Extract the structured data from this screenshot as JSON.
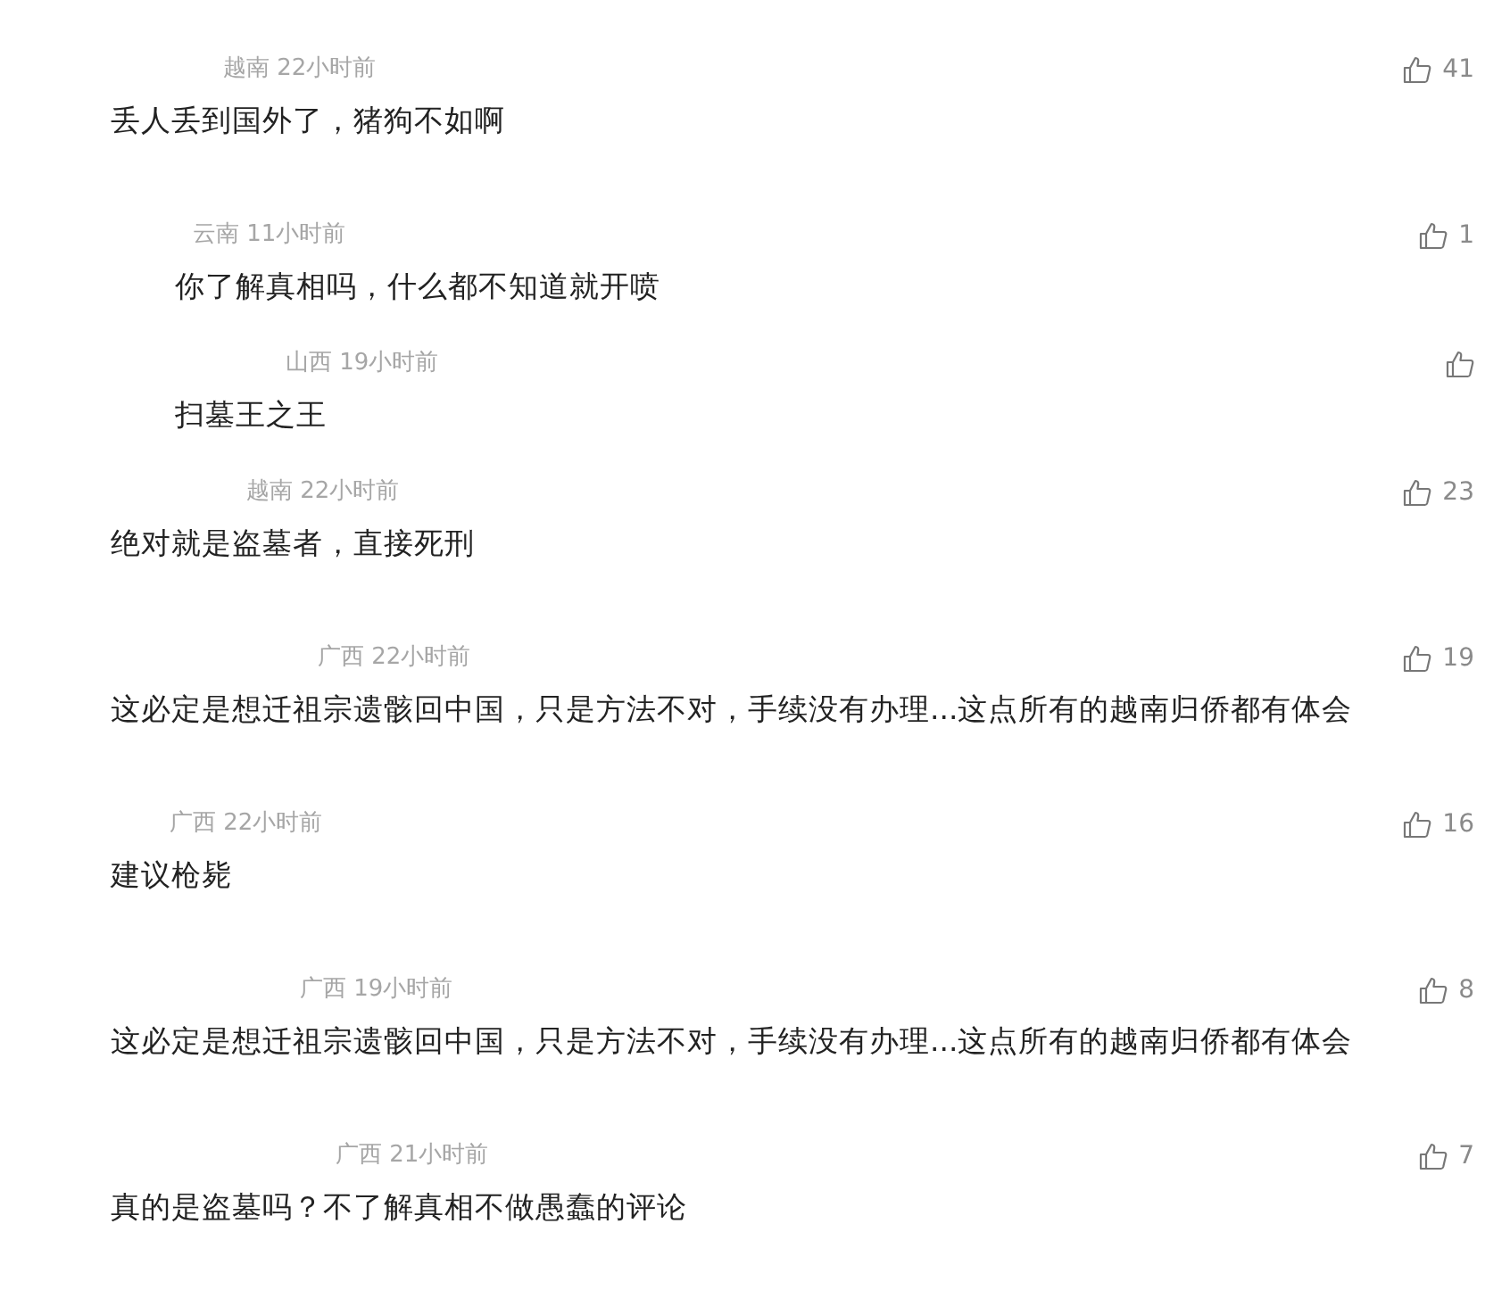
{
  "comments": [
    {
      "location": "越南",
      "time": "22小时前",
      "text": "丢人丢到国外了，猪狗不如啊",
      "likes": "41",
      "children": [
        {
          "location": "云南",
          "time": "11小时前",
          "text": "你了解真相吗，什么都不知道就开喷",
          "likes": "1"
        },
        {
          "location": "山西",
          "time": "19小时前",
          "text": "扫墓王之王"
        }
      ]
    },
    {
      "location": "越南",
      "time": "22小时前",
      "text": "绝对就是盗墓者，直接死刑",
      "likes": "23"
    },
    {
      "location": "广西",
      "time": "22小时前",
      "text": "这必定是想迁祖宗遗骸回中国，只是方法不对，手续没有办理...这点所有的越南归侨都有体会",
      "likes": "19"
    },
    {
      "location": "广西",
      "time": "22小时前",
      "text": "建议枪毙",
      "likes": "16"
    },
    {
      "location": "广西",
      "time": "19小时前",
      "text": "这必定是想迁祖宗遗骸回中国，只是方法不对，手续没有办理...这点所有的越南归侨都有体会",
      "likes": "8"
    },
    {
      "location": "广西",
      "time": "21小时前",
      "text": "真的是盗墓吗？不了解真相不做愚蠢的评论",
      "likes": "7"
    }
  ]
}
